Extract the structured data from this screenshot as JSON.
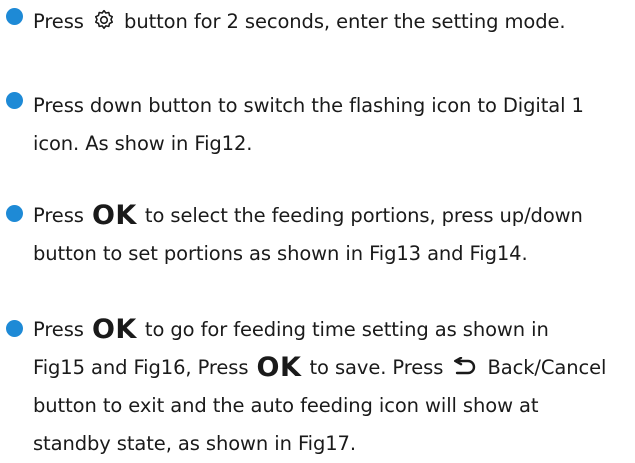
{
  "steps": [
    {
      "lines": [
        {
          "before": "Press",
          "after": "button for 2 seconds, enter the setting mode."
        }
      ]
    },
    {
      "lines": [
        "Press down button to switch the flashing icon to Digital 1",
        "icon. As show in Fig12."
      ]
    },
    {
      "lines": [
        {
          "before": "Press",
          "ok": "OK",
          "after": "to select the feeding portions, press up/down"
        },
        "button to set portions as shown in Fig13 and Fig14."
      ]
    },
    {
      "lines": [
        {
          "before": "Press",
          "ok": "OK",
          "after": "to go for feeding time setting as shown in"
        },
        {
          "before": "Fig15 and Fig16, Press",
          "ok": "OK",
          "middle": "to save. Press",
          "after": "Back/Cancel"
        },
        "button to exit and the auto feeding icon will show at",
        "standby state, as shown in Fig17."
      ]
    }
  ],
  "icons": {
    "settings": "gear-icon",
    "back": "back-arrow-icon"
  },
  "colors": {
    "bullet": "#1e8ad6",
    "text": "#1a1a1a"
  }
}
